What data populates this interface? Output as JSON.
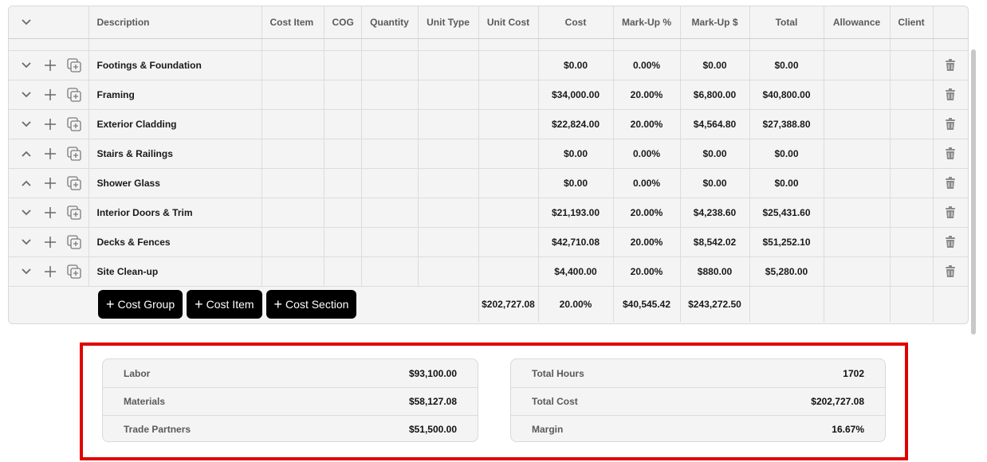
{
  "table": {
    "columns": [
      "Description",
      "Cost Item",
      "COG",
      "Quantity",
      "Unit Type",
      "Unit Cost",
      "Cost",
      "Mark-Up %",
      "Mark-Up $",
      "Total",
      "Allowance",
      "Client"
    ],
    "rows": [
      {
        "description": "Footings & Foundation",
        "cost": "$0.00",
        "markup_pct": "0.00%",
        "markup_amt": "$0.00",
        "total": "$0.00",
        "expanded": false
      },
      {
        "description": "Framing",
        "cost": "$34,000.00",
        "markup_pct": "20.00%",
        "markup_amt": "$6,800.00",
        "total": "$40,800.00",
        "expanded": false
      },
      {
        "description": "Exterior Cladding",
        "cost": "$22,824.00",
        "markup_pct": "20.00%",
        "markup_amt": "$4,564.80",
        "total": "$27,388.80",
        "expanded": false
      },
      {
        "description": "Stairs & Railings",
        "cost": "$0.00",
        "markup_pct": "0.00%",
        "markup_amt": "$0.00",
        "total": "$0.00",
        "expanded": true
      },
      {
        "description": "Shower Glass",
        "cost": "$0.00",
        "markup_pct": "0.00%",
        "markup_amt": "$0.00",
        "total": "$0.00",
        "expanded": true
      },
      {
        "description": "Interior Doors & Trim",
        "cost": "$21,193.00",
        "markup_pct": "20.00%",
        "markup_amt": "$4,238.60",
        "total": "$25,431.60",
        "expanded": false
      },
      {
        "description": "Decks & Fences",
        "cost": "$42,710.08",
        "markup_pct": "20.00%",
        "markup_amt": "$8,542.02",
        "total": "$51,252.10",
        "expanded": false
      },
      {
        "description": "Site Clean-up",
        "cost": "$4,400.00",
        "markup_pct": "20.00%",
        "markup_amt": "$880.00",
        "total": "$5,280.00",
        "expanded": false
      }
    ],
    "footer": {
      "cost": "$202,727.08",
      "markup_pct": "20.00%",
      "markup_amt": "$40,545.42",
      "total": "$243,272.50"
    },
    "buttons": {
      "cost_group": "Cost Group",
      "cost_item": "Cost Item",
      "cost_section": "Cost Section"
    }
  },
  "summary_left": [
    {
      "label": "Labor",
      "value": "$93,100.00"
    },
    {
      "label": "Materials",
      "value": "$58,127.08"
    },
    {
      "label": "Trade Partners",
      "value": "$51,500.00"
    }
  ],
  "summary_right": [
    {
      "label": "Total Hours",
      "value": "1702"
    },
    {
      "label": "Total Cost",
      "value": "$202,727.08"
    },
    {
      "label": "Margin",
      "value": "16.67%"
    }
  ],
  "colors": {
    "highlight": "#e00000",
    "button_bg": "#000000"
  }
}
